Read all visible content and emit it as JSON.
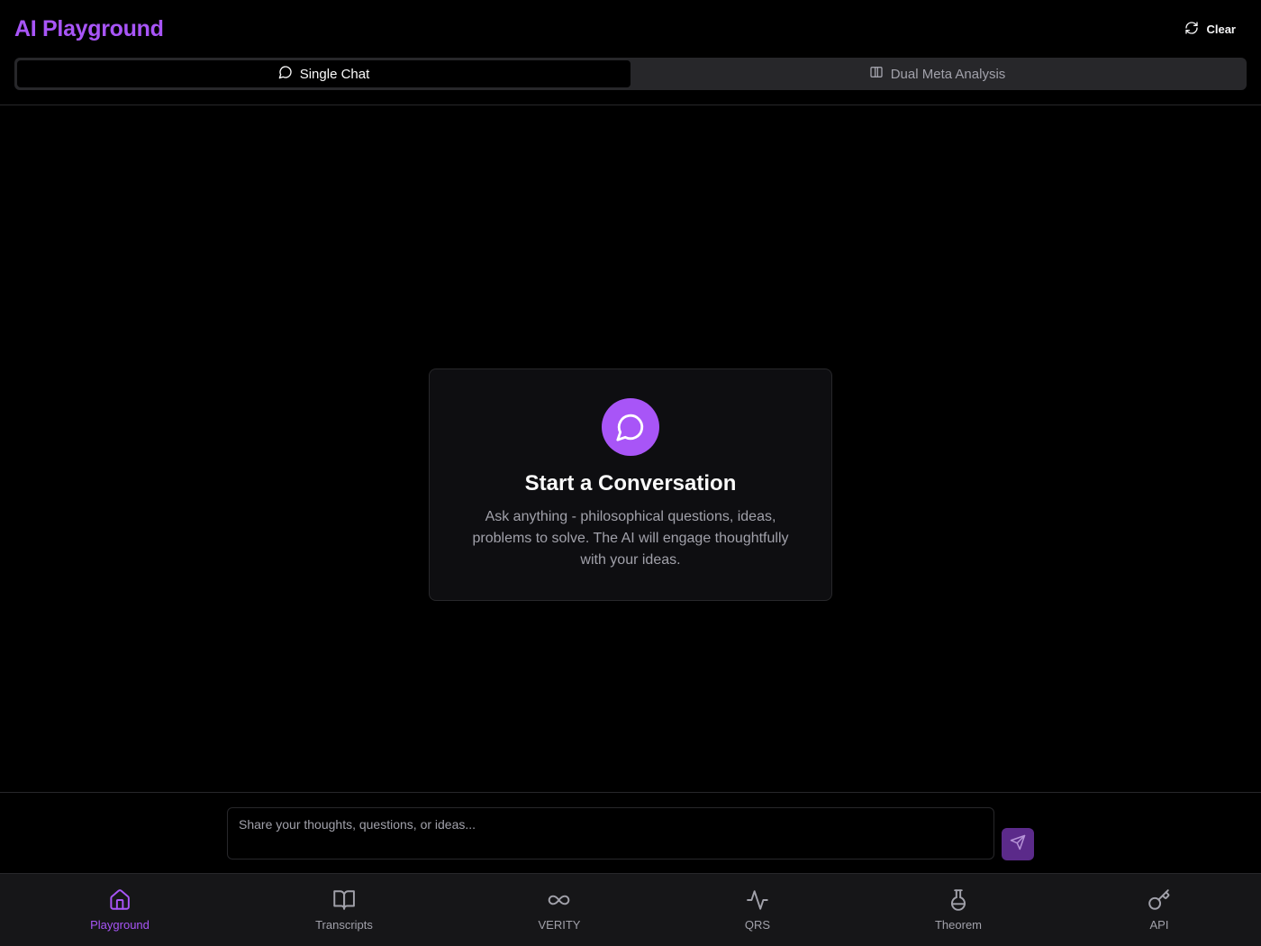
{
  "header": {
    "title": "AI Playground",
    "clear_label": "Clear"
  },
  "tabs": [
    {
      "label": "Single Chat",
      "icon": "message-circle-icon",
      "active": true
    },
    {
      "label": "Dual Meta Analysis",
      "icon": "columns-icon",
      "active": false
    }
  ],
  "empty_state": {
    "icon": "message-circle-icon",
    "title": "Start a Conversation",
    "description": "Ask anything - philosophical questions, ideas, problems to solve. The AI will engage thoughtfully with your ideas."
  },
  "composer": {
    "placeholder": "Share your thoughts, questions, or ideas...",
    "value": "",
    "send_icon": "send-icon"
  },
  "nav": [
    {
      "label": "Playground",
      "icon": "home-icon",
      "active": true
    },
    {
      "label": "Transcripts",
      "icon": "book-open-icon",
      "active": false
    },
    {
      "label": "VERITY",
      "icon": "infinity-icon",
      "active": false
    },
    {
      "label": "QRS",
      "icon": "activity-icon",
      "active": false
    },
    {
      "label": "Theorem",
      "icon": "flask-icon",
      "active": false
    },
    {
      "label": "API",
      "icon": "key-icon",
      "active": false
    }
  ],
  "colors": {
    "accent": "#a855f7",
    "background": "#000000",
    "nav_background": "#161618",
    "send_button": "#5b2a8a"
  }
}
